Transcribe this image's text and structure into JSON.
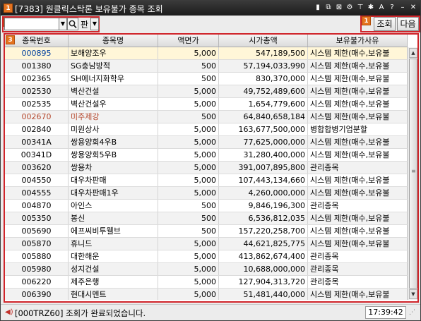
{
  "window": {
    "badge": "1",
    "title": "[7383] 원클릭스탁론 보유불가 종목 조회",
    "icons": [
      "card-icon",
      "copy-icon",
      "grid-icon",
      "settings-icon",
      "pin-icon",
      "tools-icon",
      "font-size-icon",
      "help-icon",
      "minimize-icon",
      "close-icon"
    ]
  },
  "toolbar": {
    "badge_left": "2",
    "badge_right": "1",
    "code_value": "",
    "pan_label": "판",
    "query_label": "조회",
    "next_label": "다음"
  },
  "grid": {
    "badge": "3",
    "columns": [
      "종목번호",
      "종목명",
      "액면가",
      "시가총액",
      "보유불가사유"
    ],
    "rows": [
      [
        "000895",
        "보해양조우",
        "5,000",
        "547,189,500",
        "시스템 제한(매수,보유불"
      ],
      [
        "001380",
        "SG충남방적",
        "500",
        "57,194,033,990",
        "시스템 제한(매수,보유불"
      ],
      [
        "002365",
        "SH에너지화학우",
        "500",
        "830,370,000",
        "시스템 제한(매수,보유불"
      ],
      [
        "002530",
        "벽산건설",
        "5,000",
        "49,752,489,600",
        "시스템 제한(매수,보유불"
      ],
      [
        "002535",
        "벽산건설우",
        "5,000",
        "1,654,779,600",
        "시스템 제한(매수,보유불"
      ],
      [
        "002670",
        "미주제강",
        "500",
        "64,840,658,184",
        "시스템 제한(매수,보유불"
      ],
      [
        "002840",
        "미원상사",
        "5,000",
        "163,677,500,000",
        "병합합병기업분할"
      ],
      [
        "00341A",
        "쌍용양회4우B",
        "5,000",
        "77,625,000,000",
        "시스템 제한(매수,보유불"
      ],
      [
        "00341D",
        "쌍용양회5우B",
        "5,000",
        "31,280,400,000",
        "시스템 제한(매수,보유불"
      ],
      [
        "003620",
        "쌍용차",
        "5,000",
        "391,007,895,800",
        "관리종목"
      ],
      [
        "004550",
        "대우차판매",
        "5,000",
        "107,443,134,660",
        "시스템 제한(매수,보유불"
      ],
      [
        "004555",
        "대우차판매1우",
        "5,000",
        "4,260,000,000",
        "시스템 제한(매수,보유불"
      ],
      [
        "004870",
        "아인스",
        "500",
        "9,846,196,300",
        "관리종목"
      ],
      [
        "005350",
        "봉신",
        "500",
        "6,536,812,035",
        "시스템 제한(매수,보유불"
      ],
      [
        "005690",
        "에프씨비투웰브",
        "500",
        "157,220,258,700",
        "시스템 제한(매수,보유불"
      ],
      [
        "005870",
        "휴니드",
        "5,000",
        "44,621,825,775",
        "시스템 제한(매수,보유불"
      ],
      [
        "005880",
        "대한해운",
        "5,000",
        "413,862,674,400",
        "관리종목"
      ],
      [
        "005980",
        "성지건설",
        "5,000",
        "10,688,000,000",
        "관리종목"
      ],
      [
        "006220",
        "제주은행",
        "5,000",
        "127,904,313,720",
        "관리종목"
      ],
      [
        "006390",
        "현대시멘트",
        "5,000",
        "51,481,440,000",
        "시스템 제한(매수,보유불"
      ]
    ],
    "selected_row": 0,
    "highlighted_row": 5,
    "colors": {
      "selected_bg": "#fff6d8",
      "highlight_text": "#b5482d",
      "frame_red": "#d0252b",
      "badge_orange": "#e4731f"
    }
  },
  "status": {
    "message": "[000TRZ60] 조회가 완료되었습니다.",
    "time": "17:39:42"
  }
}
